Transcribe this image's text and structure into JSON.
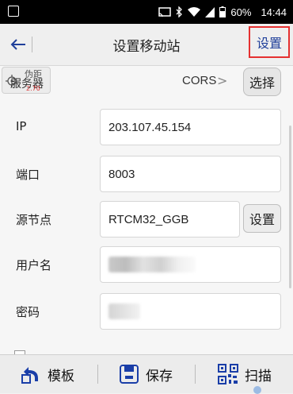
{
  "status_bar": {
    "battery": "60%",
    "time": "14:44"
  },
  "app_bar": {
    "title": "设置移动站",
    "set_label": "设置"
  },
  "server": {
    "pseudo_label": "伪距",
    "label": "服务器",
    "red_value": "2.70",
    "mode": "CORS",
    "choose_label": "选择"
  },
  "form": {
    "ip": {
      "label": "IP",
      "value": "203.107.45.154"
    },
    "port": {
      "label": "端口",
      "value": "8003"
    },
    "mountpoint": {
      "label": "源节点",
      "value": "RTCM32_GGB",
      "button": "设置"
    },
    "username": {
      "label": "用户名",
      "value": ""
    },
    "password": {
      "label": "密码",
      "value": ""
    }
  },
  "bottom_bar": {
    "template_label": "模板",
    "save_label": "保存",
    "scan_label": "扫描"
  },
  "colors": {
    "accent_blue": "#1f3f9a",
    "highlight_red": "#e53030",
    "icon_blue": "#1a3ea8"
  }
}
